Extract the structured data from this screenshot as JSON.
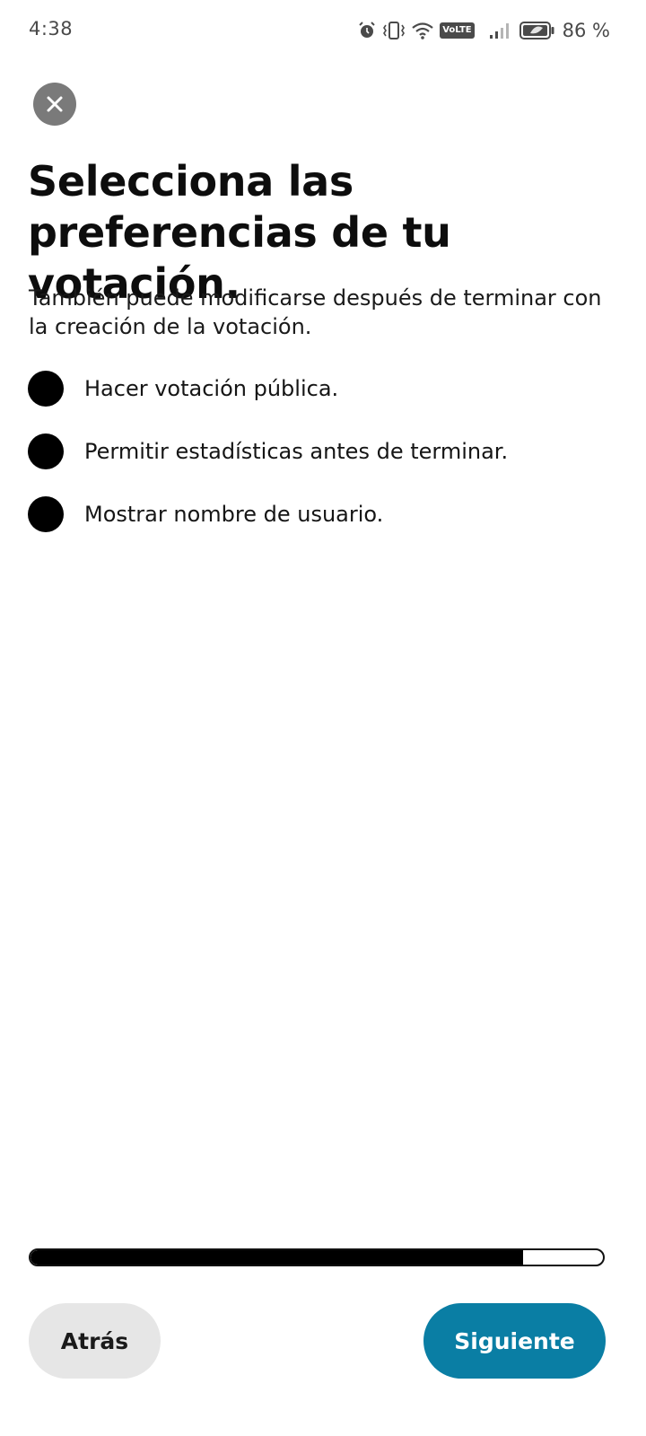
{
  "status_bar": {
    "time": "4:38",
    "battery_percent": "86 %",
    "volte_label": "VoLTE",
    "icons": [
      "alarm-icon",
      "vibrate-icon",
      "wifi-icon",
      "volte-icon",
      "signal-icon",
      "battery-icon"
    ]
  },
  "header": {
    "close_icon": "close-icon",
    "title": "Selecciona las preferencias de tu votación.",
    "subtitle": "También puede modificarse después de terminar con la creación de la votación."
  },
  "options": [
    {
      "label": "Hacer votación pública."
    },
    {
      "label": "Permitir estadísticas antes de terminar."
    },
    {
      "label": "Mostrar nombre de usuario."
    }
  ],
  "progress": {
    "value": 0.86
  },
  "footer": {
    "back_label": "Atrás",
    "next_label": "Siguiente"
  },
  "colors": {
    "accent": "#0a7ea4",
    "secondary_button": "#e6e6e6",
    "close_button": "#7a7a7a",
    "option_dot": "#000000"
  }
}
